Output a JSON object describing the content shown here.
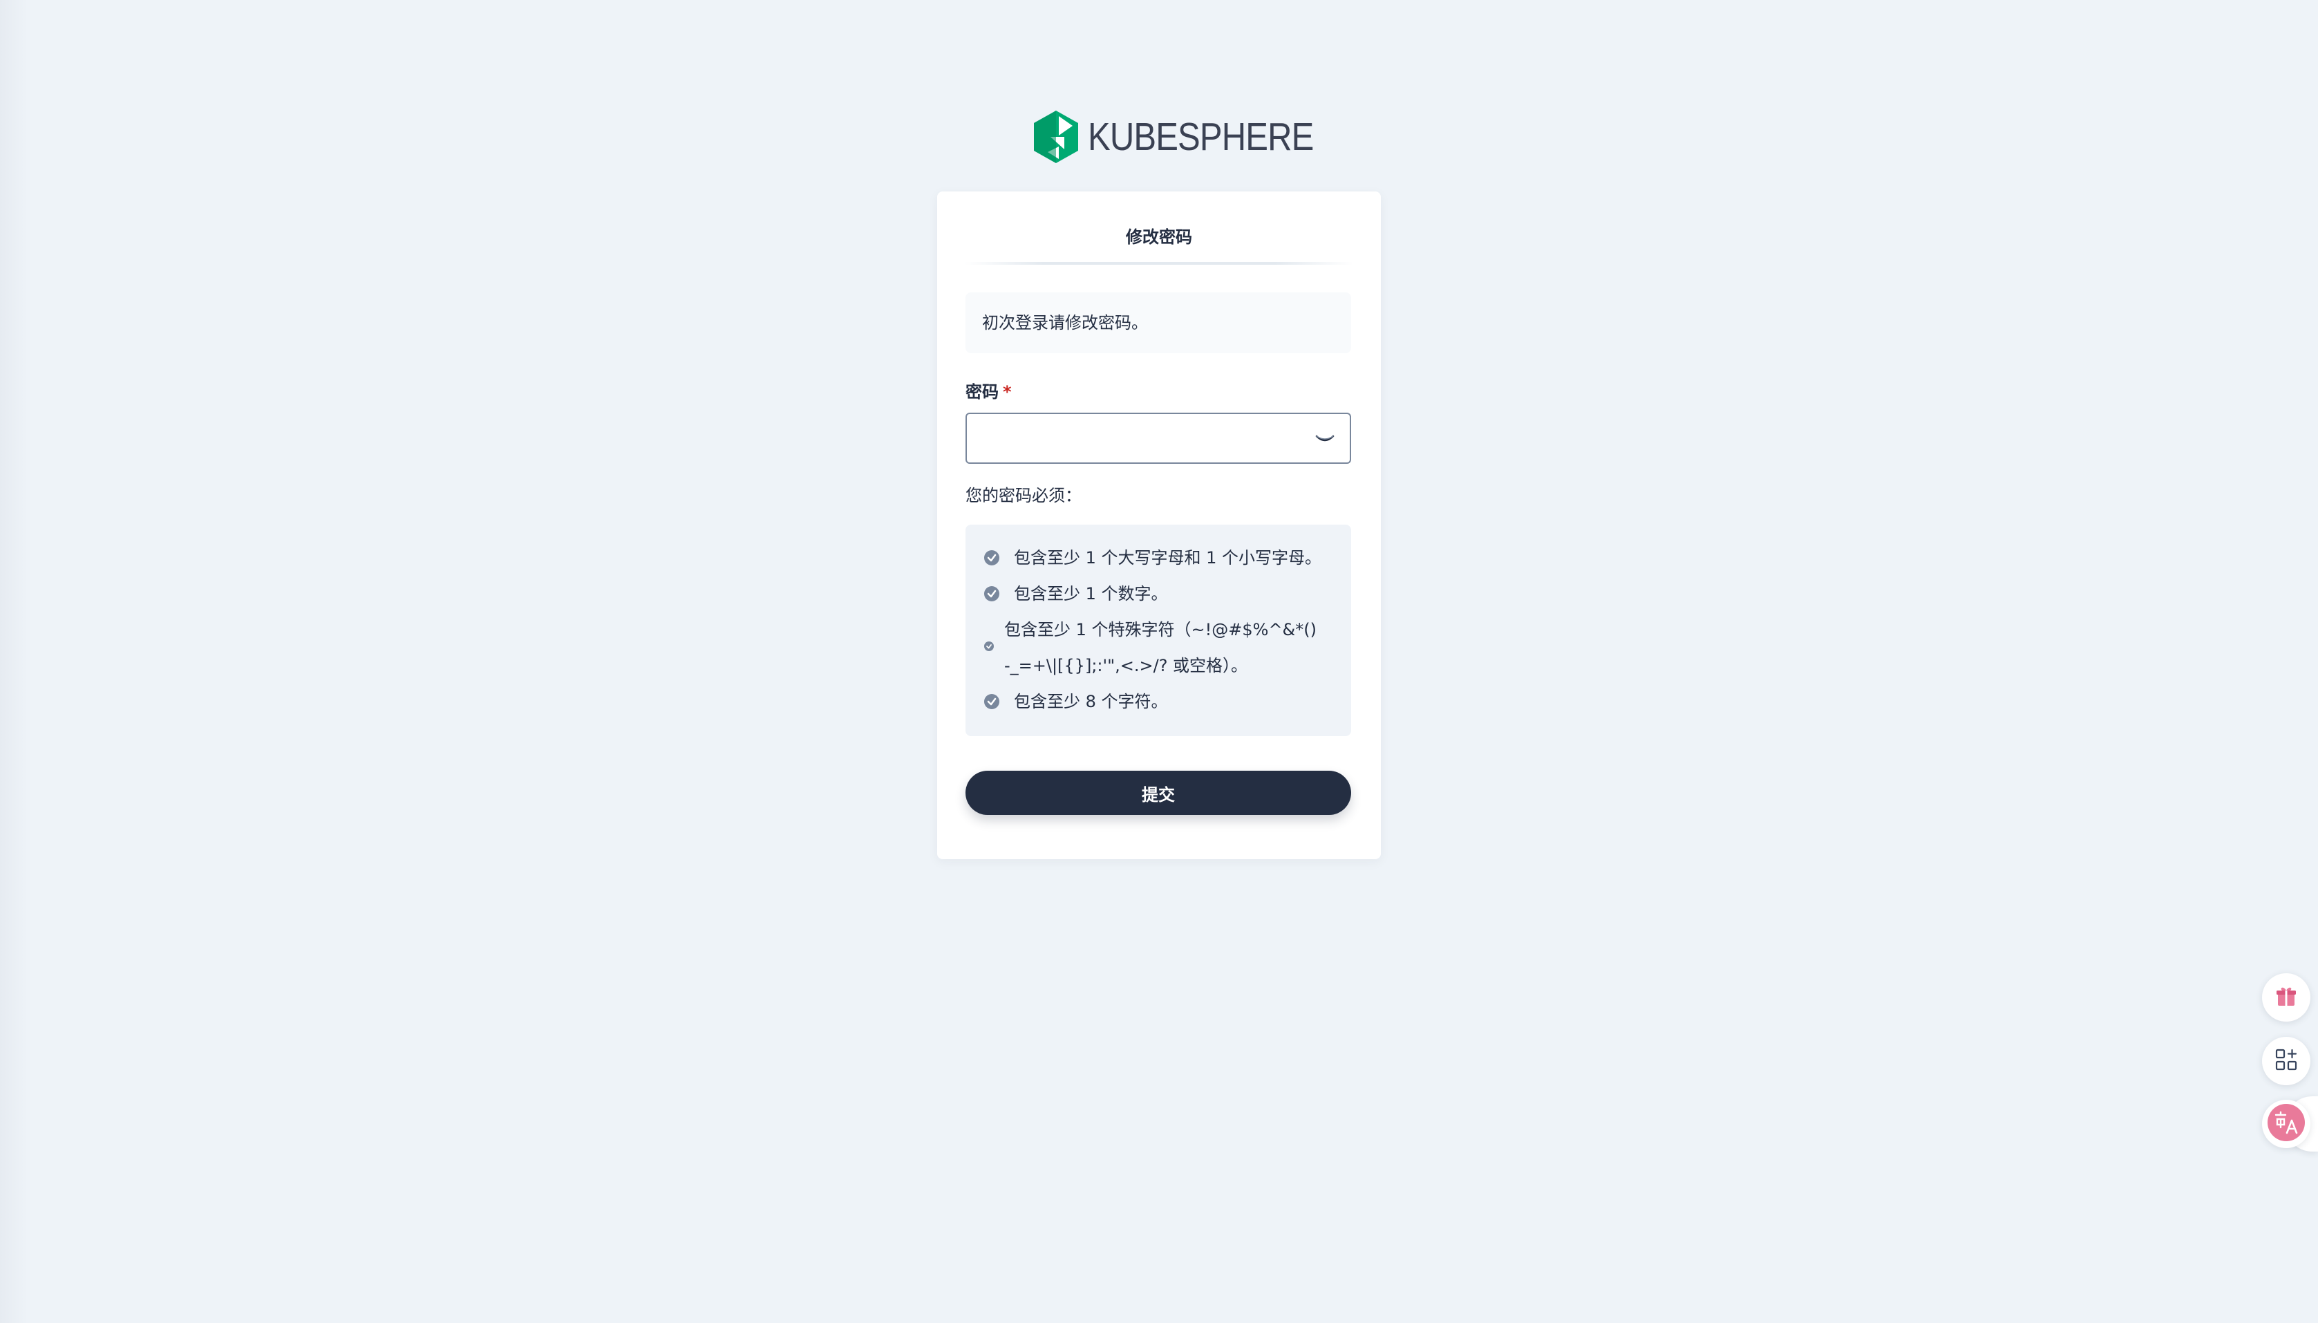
{
  "brand": {
    "logo_text": "KUBESPHERE",
    "logo_color": "#00aa72"
  },
  "card": {
    "title": "修改密码",
    "notice": "初次登录请修改密码。",
    "password_label": "密码",
    "required_mark": "*",
    "password_value": "",
    "password_placeholder": "",
    "rules_title": "您的密码必须：",
    "rules": [
      {
        "text": "包含至少 1 个大写字母和 1 个小写字母。",
        "met": true
      },
      {
        "text": "包含至少 1 个数字。",
        "met": true
      },
      {
        "text": "包含至少 1 个特殊字符（~!@#$%^&*()-_=+\\|[{}];:'\",<.>/? 或空格）。",
        "met": true
      },
      {
        "text": "包含至少 8 个字符。",
        "met": true
      }
    ],
    "submit_label": "提交"
  },
  "floating_tools": [
    {
      "icon": "gift-icon"
    },
    {
      "icon": "apps-add-icon"
    },
    {
      "icon": "translate-icon"
    }
  ],
  "colors": {
    "background": "#eef3f8",
    "primary_dark": "#242e42",
    "required": "#ca2621",
    "check": "#79879c",
    "accent_pink": "#e97a9a"
  }
}
